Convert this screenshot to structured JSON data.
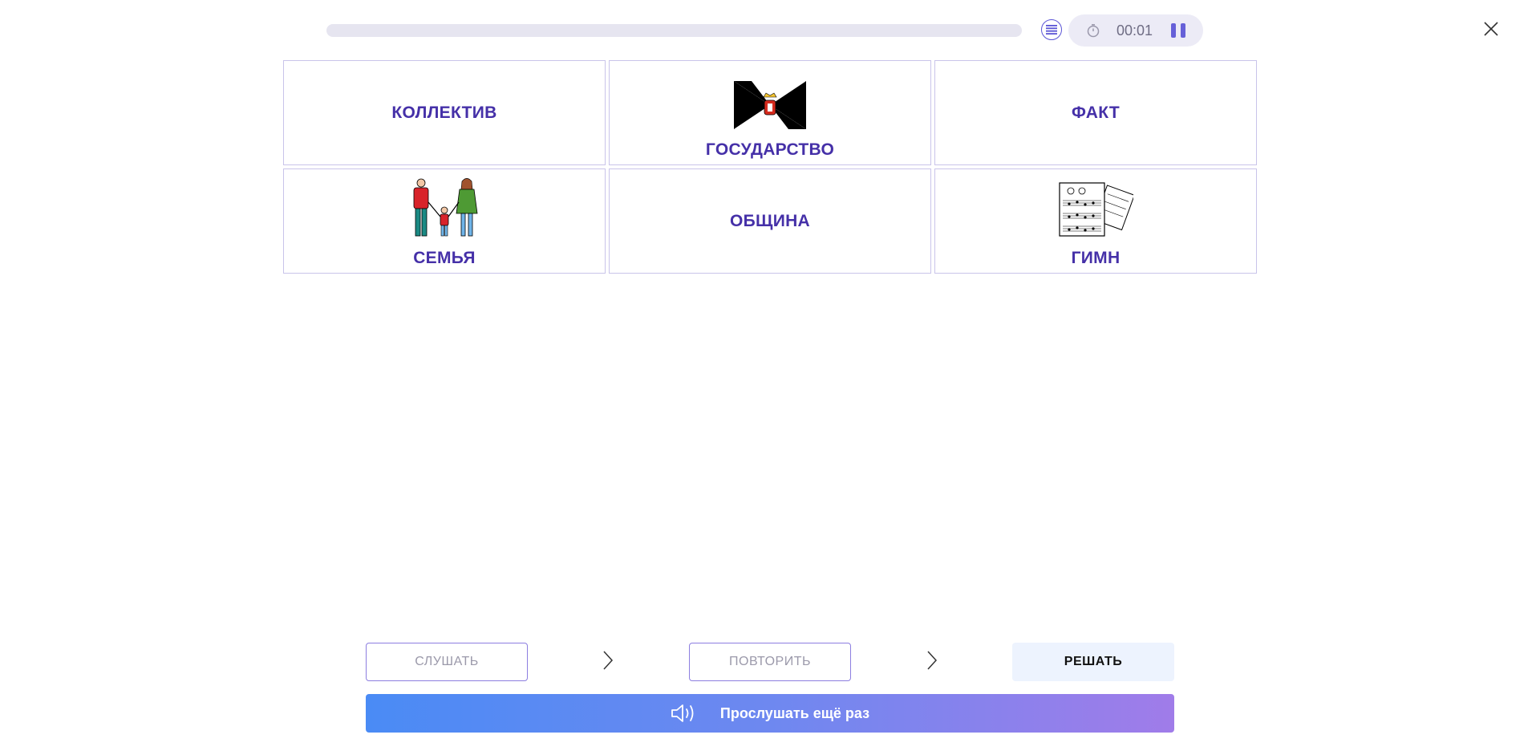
{
  "progress": {
    "fraction": 0.0
  },
  "timer": {
    "time": "00:01"
  },
  "cards": [
    {
      "label": "КОЛЛЕКТИВ",
      "image": ""
    },
    {
      "label": "ГОСУДАРСТВО",
      "image": "flag-icon"
    },
    {
      "label": "ФАКТ",
      "image": ""
    },
    {
      "label": "СЕМЬЯ",
      "image": "family-icon"
    },
    {
      "label": "ОБЩИНА",
      "image": ""
    },
    {
      "label": "ГИМН",
      "image": "sheet-music-icon"
    }
  ],
  "steps": {
    "listen": "СЛУШАТЬ",
    "repeat": "ПОВТОРИТЬ",
    "solve": "РЕШАТЬ"
  },
  "listen_again": {
    "label": "Прослушать ещё раз"
  },
  "colors": {
    "accent": "#4530a8",
    "card_border": "#c9c4ea",
    "gradient_start": "#4a8bf5",
    "gradient_end": "#a07ce9"
  }
}
